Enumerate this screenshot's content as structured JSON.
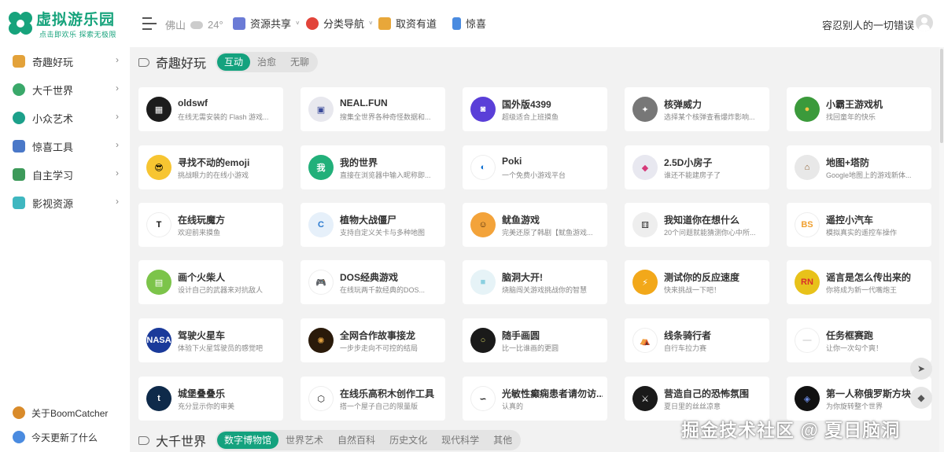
{
  "header": {
    "logo_title": "虚拟游乐园",
    "logo_sub": "点击即欢乐 探索无极限",
    "weather_city": "佛山",
    "weather_temp": "24°",
    "nav": [
      {
        "label": "资源共享",
        "has_caret": true,
        "icon_color": "#6b7bd6"
      },
      {
        "label": "分类导航",
        "has_caret": true,
        "icon_color": "#e2443a"
      },
      {
        "label": "取资有道",
        "has_caret": false,
        "icon_color": "#e8a73a"
      },
      {
        "label": "惊喜",
        "has_caret": false,
        "icon_color": "#4a8be0"
      }
    ],
    "motto": "容忍别人的一切错误"
  },
  "sidebar": {
    "items": [
      {
        "label": "奇趣好玩",
        "icon_color": "#e3a23a"
      },
      {
        "label": "大千世界",
        "icon_color": "#3aa86a"
      },
      {
        "label": "小众艺术",
        "icon_color": "#1ca08a"
      },
      {
        "label": "惊喜工具",
        "icon_color": "#4a78c8"
      },
      {
        "label": "自主学习",
        "icon_color": "#3d9a5a"
      },
      {
        "label": "影视资源",
        "icon_color": "#3fb7c0"
      }
    ],
    "footer": [
      {
        "label": "关于BoomCatcher",
        "icon_color": "#d98b2a"
      },
      {
        "label": "今天更新了什么",
        "icon_color": "#4a8be0"
      }
    ]
  },
  "sections": [
    {
      "title": "奇趣好玩",
      "tabs": [
        "互动",
        "治愈",
        "无聊"
      ],
      "active_tab": 0
    },
    {
      "title": "大千世界",
      "tabs": [
        "数字博物馆",
        "世界艺术",
        "自然百科",
        "历史文化",
        "现代科学",
        "其他"
      ],
      "active_tab": 0
    }
  ],
  "cards": [
    {
      "title": "oldswf",
      "desc": "在线无需安装的 Flash 游戏...",
      "icon_bg": "#1c1c1c",
      "icon_text": "▦",
      "icon_fg": "#fff"
    },
    {
      "title": "NEAL.FUN",
      "desc": "搜集全世界各种奇怪数据和...",
      "icon_bg": "#e8e8ee",
      "icon_text": "▣",
      "icon_fg": "#3a4a9a"
    },
    {
      "title": "国外版4399",
      "desc": "超级适合上班摸鱼",
      "icon_bg": "#5a3fd8",
      "icon_text": "◙",
      "icon_fg": "#fff"
    },
    {
      "title": "核弹威力",
      "desc": "选择某个核弹查看爆炸影响...",
      "icon_bg": "#777",
      "icon_text": "✦",
      "icon_fg": "#fff"
    },
    {
      "title": "小霸王游戏机",
      "desc": "找回童年的快乐",
      "icon_bg": "#3b9a3b",
      "icon_text": "●",
      "icon_fg": "#f5c542"
    },
    {
      "title": "寻找不动的emoji",
      "desc": "挑战眼力的在线小游戏",
      "icon_bg": "#f7c531",
      "icon_text": "😎",
      "icon_fg": "#000"
    },
    {
      "title": "我的世界",
      "desc": "直接在浏览器中输入昵称即...",
      "icon_bg": "#22b07a",
      "icon_text": "我",
      "icon_fg": "#fff"
    },
    {
      "title": "Poki",
      "desc": "一个免费小游戏平台",
      "icon_bg": "#fff",
      "icon_text": "◐",
      "icon_fg": "#0a6ccf"
    },
    {
      "title": "2.5D小房子",
      "desc": "谁还不能建房子了",
      "icon_bg": "#e8e8f0",
      "icon_text": "◆",
      "icon_fg": "#d63a7a"
    },
    {
      "title": "地图+塔防",
      "desc": "Google地图上的游戏新体...",
      "icon_bg": "#e8e8e8",
      "icon_text": "⌂",
      "icon_fg": "#8a5a2a"
    },
    {
      "title": "在线玩魔方",
      "desc": "欢迎前来摸鱼",
      "icon_bg": "#fff",
      "icon_text": "T",
      "icon_fg": "#111"
    },
    {
      "title": "植物大战僵尸",
      "desc": "支持自定义关卡与多种地图",
      "icon_bg": "#e6f0fa",
      "icon_text": "C",
      "icon_fg": "#2a7ad0"
    },
    {
      "title": "鱿鱼游戏",
      "desc": "完美还原了韩剧【鱿鱼游戏...",
      "icon_bg": "#f3a33a",
      "icon_text": "☺",
      "icon_fg": "#4a2a0a"
    },
    {
      "title": "我知道你在想什么",
      "desc": "20个问题就能猜测你心中所...",
      "icon_bg": "#eee",
      "icon_text": "⚅",
      "icon_fg": "#333"
    },
    {
      "title": "遥控小汽车",
      "desc": "模拟真实的遥控车操作",
      "icon_bg": "#fff",
      "icon_text": "BS",
      "icon_fg": "#f0a030"
    },
    {
      "title": "画个火柴人",
      "desc": "设计自己的武器来对抗敌人",
      "icon_bg": "#7cc44a",
      "icon_text": "▤",
      "icon_fg": "#fff"
    },
    {
      "title": "DOS经典游戏",
      "desc": "在线玩两千款经典的DOS...",
      "icon_bg": "#fff",
      "icon_text": "🎮",
      "icon_fg": "#333"
    },
    {
      "title": "脑洞大开!",
      "desc": "烧脑闯关游戏挑战你的智慧",
      "icon_bg": "#e6f3f7",
      "icon_text": "■",
      "icon_fg": "#8ad0e0"
    },
    {
      "title": "测试你的反应速度",
      "desc": "快来挑战一下吧！",
      "icon_bg": "#f2a81a",
      "icon_text": "⚡",
      "icon_fg": "#fff"
    },
    {
      "title": "谣言是怎么传出来的",
      "desc": "你将成为新一代嘴炮王",
      "icon_bg": "#e8c21a",
      "icon_text": "RN",
      "icon_fg": "#d8302a"
    },
    {
      "title": "驾驶火星车",
      "desc": "体验下火星驾驶员的感觉吧",
      "icon_bg": "#1a3a9a",
      "icon_text": "NASA",
      "icon_fg": "#fff"
    },
    {
      "title": "全网合作故事接龙",
      "desc": "一步步走向不可控的结局",
      "icon_bg": "#2a1a0a",
      "icon_text": "✺",
      "icon_fg": "#e0a040"
    },
    {
      "title": "随手画圆",
      "desc": "比一比谁画的更圆",
      "icon_bg": "#1a1a1a",
      "icon_text": "○",
      "icon_fg": "#d0d060"
    },
    {
      "title": "线条骑行者",
      "desc": "自行车拉力赛",
      "icon_bg": "#fff",
      "icon_text": "⛺",
      "icon_fg": "#111"
    },
    {
      "title": "任务框赛跑",
      "desc": "让你一次勾个爽！",
      "icon_bg": "#fff",
      "icon_text": "—",
      "icon_fg": "#ccc"
    },
    {
      "title": "城堡叠叠乐",
      "desc": "充分显示你的审美",
      "icon_bg": "#0e2a4a",
      "icon_text": "t",
      "icon_fg": "#fff"
    },
    {
      "title": "在线乐高积木创作工具",
      "desc": "搭一个屋子自己的限量版",
      "icon_bg": "#fff",
      "icon_text": "⬡",
      "icon_fg": "#111"
    },
    {
      "title": "光敏性癫痫患者请勿访...",
      "desc": "认真的",
      "icon_bg": "#fff",
      "icon_text": "∽",
      "icon_fg": "#111"
    },
    {
      "title": "营造自己的恐怖氛围",
      "desc": "夏日里的丝丝凉意",
      "icon_bg": "#1a1a1a",
      "icon_text": "⚔",
      "icon_fg": "#fff"
    },
    {
      "title": "第一人称俄罗斯方块",
      "desc": "为你旋转整个世界",
      "icon_bg": "#111",
      "icon_text": "◈",
      "icon_fg": "#6a8ae0"
    }
  ],
  "watermark": "掘金技术社区 @ 夏日脑洞"
}
